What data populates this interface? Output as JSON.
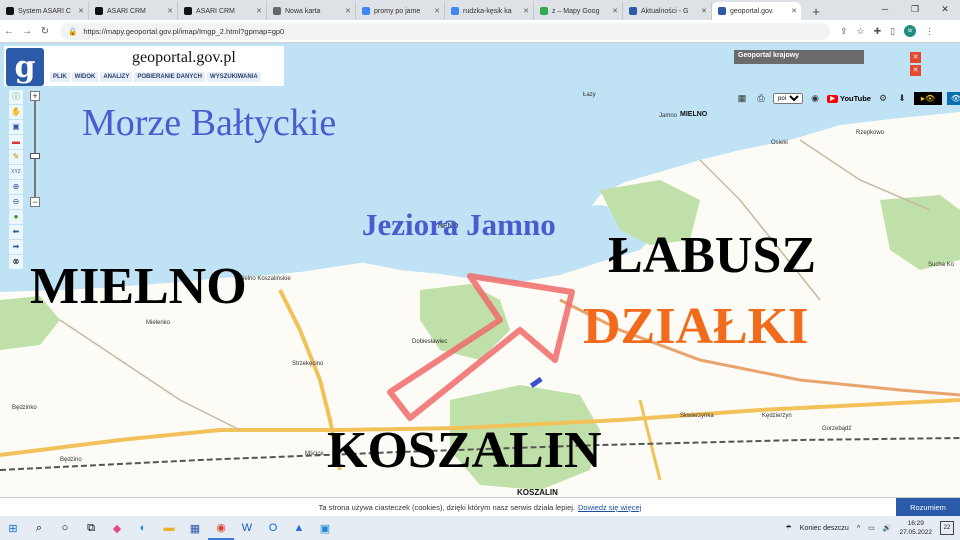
{
  "browser": {
    "tabs": [
      {
        "title": "System ASARI C",
        "favicon": "asari-icon",
        "color": "#111111"
      },
      {
        "title": "ASARI CRM",
        "favicon": "asari-icon",
        "color": "#111111"
      },
      {
        "title": "ASARI CRM",
        "favicon": "asari-icon",
        "color": "#111111"
      },
      {
        "title": "Nowa karta",
        "favicon": "globe-icon",
        "color": "#666666"
      },
      {
        "title": "promy po jame",
        "favicon": "google-icon",
        "color": "#4285f4"
      },
      {
        "title": "rudzka-kęsik ka",
        "favicon": "google-icon",
        "color": "#4285f4"
      },
      {
        "title": "z – Mapy Goog",
        "favicon": "maps-icon",
        "color": "#34a853"
      },
      {
        "title": "Aktualności - G",
        "favicon": "geoportal-icon",
        "color": "#2b5aa8"
      },
      {
        "title": "geoportal.gov.",
        "favicon": "geoportal-icon",
        "color": "#2b5aa8",
        "active": true
      }
    ],
    "new_tab": "+",
    "url": "https://mapy.geoportal.gov.pl/imap/Imgp_2.html?gpmap=gp0",
    "profile_initial": "w"
  },
  "geoportal": {
    "logo_letter": "g",
    "brand": "geoportal.gov.pl",
    "menu": [
      "PLIK",
      "WIDOK",
      "ANALIZY",
      "POBIERANIE DANYCH",
      "WYSZUKIWANIA"
    ],
    "panel_title": "Geoportal krajowy",
    "language": "pol",
    "youtube": "YouTube"
  },
  "map": {
    "overlay_labels": {
      "sea": "Morze Bałtyckie",
      "lake": "Jeziora Jamno",
      "mielno": "MIELNO",
      "labusz": "ŁABUSZ",
      "dzialki": "DZIAŁKI",
      "koszalin": "KOSZALIN"
    },
    "place_labels": {
      "jamno": "Jamno",
      "mielno_small": "MIELNO",
      "mielno_koszalinskie": "Mielno Koszalińskie",
      "mielenko": "Mielenko",
      "dobieslawiec": "Dobiesławiec",
      "strzekecino": "Strzekęcino",
      "bedzino": "Będzino",
      "bedzinko": "Będzinko",
      "mscice": "Mścice",
      "koszalin_small": "KOSZALIN",
      "skwierzynka": "Skwierzynka",
      "kedzierzyn": "Kędzierzyn",
      "gorzebadz": "Gorzebądź",
      "sucha_ko": "Sucha Ko",
      "osieki": "Osieki",
      "rzepkowo": "Rzepkowo",
      "laz": "Łazy",
      "neno": "NENO"
    },
    "colors": {
      "sea": "#bfe3f5",
      "land": "#fdfbf5",
      "forest": "#bfe0a8",
      "arrow": "#f06a6a",
      "road": "#f2c25a",
      "dzialki": "#f26a1b",
      "overlay_blue": "#4a5bd0"
    }
  },
  "cookie": {
    "text": "Ta strona używa ciasteczek (cookies), dzięki którym nasz serwis działa lepiej.",
    "link": "Dowiedz się więcej",
    "button": "Rozumiem"
  },
  "taskbar": {
    "weather": "Koniec deszczu",
    "time": "16:29",
    "date": "27.05.2022",
    "notifications": "22"
  }
}
